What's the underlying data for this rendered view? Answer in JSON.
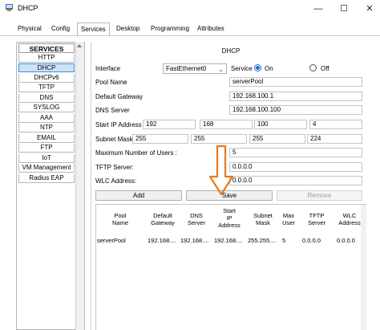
{
  "window": {
    "title": "DHCP",
    "minimize_glyph": "—",
    "maximize_glyph": "☐",
    "close_glyph": "✕",
    "icon": "router-icon"
  },
  "tabs": [
    {
      "label": "Physical"
    },
    {
      "label": "Config"
    },
    {
      "label": "Services"
    },
    {
      "label": "Desktop"
    },
    {
      "label": "Programming"
    },
    {
      "label": "Attributes"
    }
  ],
  "active_tab": "Services",
  "services": {
    "header": "SERVICES",
    "items": [
      "HTTP",
      "DHCP",
      "DHCPv6",
      "TFTP",
      "DNS",
      "SYSLOG",
      "AAA",
      "NTP",
      "EMAIL",
      "FTP",
      "IoT",
      "VM Management",
      "Radius EAP"
    ],
    "selected": "DHCP"
  },
  "dhcp": {
    "section_title": "DHCP",
    "interface_label": "Interface",
    "interface_value": "FastEthernet0",
    "service_label": "Service",
    "on_label": "On",
    "off_label": "Off",
    "service_state": "On",
    "pool_name_label": "Pool Name",
    "pool_name_value": "serverPool",
    "gateway_label": "Default Gateway",
    "gateway_value": "192.168.100.1",
    "dns_label": "DNS Server",
    "dns_value": "192.168.100.100",
    "start_ip_label": "Start IP Address :",
    "start_ip": [
      "192",
      "168",
      "100",
      "4"
    ],
    "subnet_label": "Subnet Mask:",
    "subnet": [
      "255",
      "255",
      "255",
      "224"
    ],
    "max_users_label": "Maximum Number of Users :",
    "max_users_value": "5",
    "tftp_label": "TFTP Server:",
    "tftp_value": "0.0.0.0",
    "wlc_label": "WLC Address:",
    "wlc_value": "0.0.0.0",
    "buttons": {
      "add": "Add",
      "save": "Save",
      "remove": "Remove"
    },
    "accent_color": "#e87a1e"
  },
  "table": {
    "columns": [
      "Pool\nName",
      "Default\nGateway",
      "DNS\nServer",
      "Start\nIP\nAddress",
      "Subnet\nMask",
      "Max\nUser",
      "TFTP\nServer",
      "WLC\nAddress"
    ],
    "rows": [
      [
        "serverPool",
        "192.168....",
        "192.168....",
        "192.168....",
        "255.255....",
        "5",
        "0.0.0.0",
        "0.0.0.0"
      ]
    ]
  }
}
